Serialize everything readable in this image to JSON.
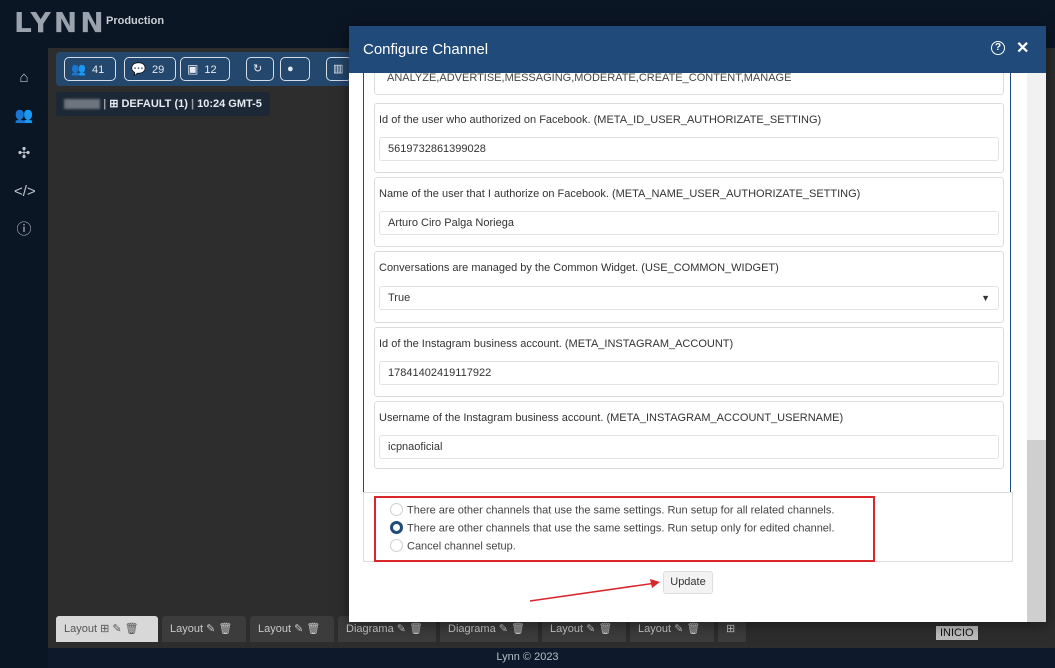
{
  "app": {
    "logo": "LYNN",
    "environment": "Production"
  },
  "toolbar": {
    "users_count": "41",
    "conversations_count": "29",
    "bots_count": "12"
  },
  "info_badge": {
    "tenant": "DEFAULT",
    "count": "(1)",
    "time": "10:24 GMT-5"
  },
  "nav_icons": [
    "home-icon",
    "users-icon",
    "network-icon",
    "code-icon",
    "info-icon"
  ],
  "dialog": {
    "title": "Configure Channel",
    "top_cut_value": "ANALYZE,ADVERTISE,MESSAGING,MODERATE,CREATE_CONTENT,MANAGE",
    "fields": [
      {
        "label": "Id of the user who authorized on Facebook. (META_ID_USER_AUTHORIZATE_SETTING)",
        "value": "5619732861399028"
      },
      {
        "label": "Name of the user that I authorize on Facebook. (META_NAME_USER_AUTHORIZATE_SETTING)",
        "value": "Arturo Ciro Palga Noriega"
      },
      {
        "label": "Conversations are managed by the Common Widget. (USE_COMMON_WIDGET)",
        "value": "True"
      },
      {
        "label": "Id of the Instagram business account. (META_INSTAGRAM_ACCOUNT)",
        "value": "17841402419117922"
      },
      {
        "label": "Username of the Instagram business account. (META_INSTAGRAM_ACCOUNT_USERNAME)",
        "value": "icpnaoficial"
      }
    ],
    "options": [
      "There are other channels that use the same settings. Run setup for all related channels.",
      "There are other channels that use the same settings. Run setup only for edited channel.",
      "Cancel channel setup."
    ],
    "selected_option": 1,
    "update_label": "Update"
  },
  "bottom_tabs": [
    "Layout",
    "Layout",
    "Layout",
    "Diagrama",
    "Diagrama",
    "Layout",
    "Layout"
  ],
  "flow_label": "INICIO",
  "footer": "Lynn © 2023",
  "colors": {
    "header": "#1f4a7a",
    "highlight": "#d9262b",
    "background": "#0e1a2b"
  }
}
